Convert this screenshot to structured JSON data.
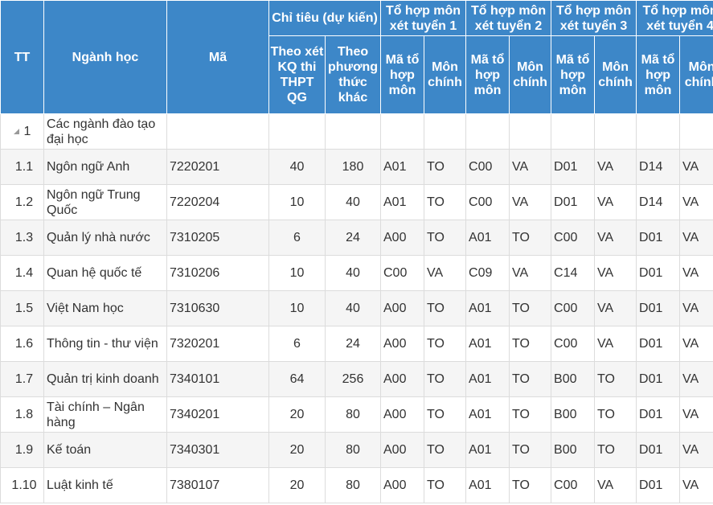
{
  "header": {
    "tt": "TT",
    "nganh": "Ngành học",
    "ma": "Mã",
    "chi_tieu": "Chỉ tiêu (dự kiến)",
    "theo_kq": "Theo xét KQ thi THPT QG",
    "theo_pt": "Theo phương thức khác",
    "groups": [
      "Tổ hợp môn xét tuyển 1",
      "Tổ hợp môn xét tuyển 2",
      "Tổ hợp môn xét tuyển 3",
      "Tổ hợp môn xét tuyển 4"
    ],
    "ma_to_hop": "Mã tổ hợp môn",
    "mon_chinh": "Môn chính"
  },
  "section": {
    "tt": "1",
    "name": "Các ngành đào tạo đại học"
  },
  "rows": [
    [
      "1.1",
      "Ngôn ngữ Anh",
      "7220201",
      "40",
      "180",
      "A01",
      "TO",
      "C00",
      "VA",
      "D01",
      "VA",
      "D14",
      "VA"
    ],
    [
      "1.2",
      "Ngôn ngữ Trung Quốc",
      "7220204",
      "10",
      "40",
      "A01",
      "TO",
      "C00",
      "VA",
      "D01",
      "VA",
      "D14",
      "VA"
    ],
    [
      "1.3",
      "Quản lý nhà nước",
      "7310205",
      "6",
      "24",
      "A00",
      "TO",
      "A01",
      "TO",
      "C00",
      "VA",
      "D01",
      "VA"
    ],
    [
      "1.4",
      "Quan hệ quốc tế",
      "7310206",
      "10",
      "40",
      "C00",
      "VA",
      "C09",
      "VA",
      "C14",
      "VA",
      "D01",
      "VA"
    ],
    [
      "1.5",
      "Việt Nam học",
      "7310630",
      "10",
      "40",
      "A00",
      "TO",
      "A01",
      "TO",
      "C00",
      "VA",
      "D01",
      "VA"
    ],
    [
      "1.6",
      "Thông tin - thư viện",
      "7320201",
      "6",
      "24",
      "A00",
      "TO",
      "A01",
      "TO",
      "C00",
      "VA",
      "D01",
      "VA"
    ],
    [
      "1.7",
      "Quản trị kinh doanh",
      "7340101",
      "64",
      "256",
      "A00",
      "TO",
      "A01",
      "TO",
      "B00",
      "TO",
      "D01",
      "VA"
    ],
    [
      "1.8",
      "Tài chính – Ngân hàng",
      "7340201",
      "20",
      "80",
      "A00",
      "TO",
      "A01",
      "TO",
      "B00",
      "TO",
      "D01",
      "VA"
    ],
    [
      "1.9",
      "Kế toán",
      "7340301",
      "20",
      "80",
      "A00",
      "TO",
      "A01",
      "TO",
      "B00",
      "TO",
      "D01",
      "VA"
    ],
    [
      "1.10",
      "Luật kinh tế",
      "7380107",
      "20",
      "80",
      "A00",
      "TO",
      "A01",
      "TO",
      "C00",
      "VA",
      "D01",
      "VA"
    ]
  ],
  "colors": {
    "header_bg": "#3d87c8",
    "header_text": "#ffffff",
    "row_alt": "#f5f5f5"
  },
  "icons": {
    "section_toggle": "collapse-triangle-icon"
  }
}
